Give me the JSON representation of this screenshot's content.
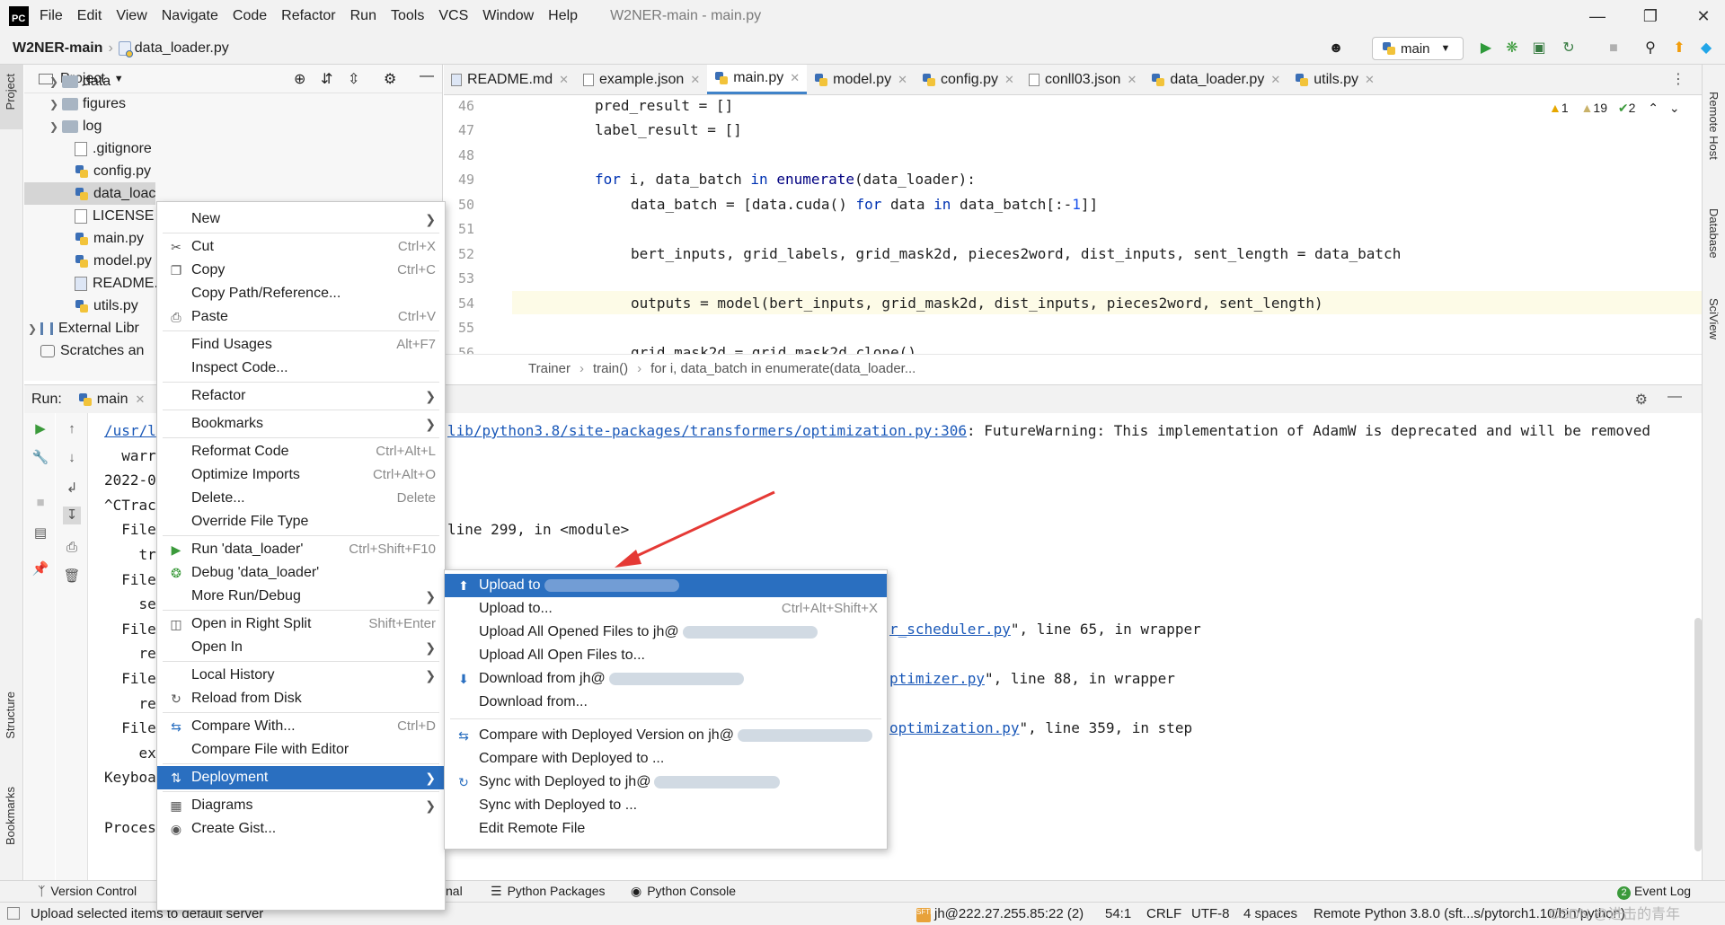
{
  "menubar": {
    "items": [
      "File",
      "Edit",
      "View",
      "Navigate",
      "Code",
      "Refactor",
      "Run",
      "Tools",
      "VCS",
      "Window",
      "Help"
    ],
    "window_title": "W2NER-main - main.py"
  },
  "navbar": {
    "project": "W2NER-main",
    "file": "data_loader.py",
    "run_config": "main"
  },
  "project_panel": {
    "title": "Project",
    "items": [
      {
        "label": "data",
        "kind": "folder"
      },
      {
        "label": "figures",
        "kind": "folder"
      },
      {
        "label": "log",
        "kind": "folder"
      },
      {
        "label": ".gitignore",
        "kind": "file"
      },
      {
        "label": "config.py",
        "kind": "py"
      },
      {
        "label": "data_loac",
        "kind": "py"
      },
      {
        "label": "LICENSE",
        "kind": "file"
      },
      {
        "label": "main.py",
        "kind": "py"
      },
      {
        "label": "model.py",
        "kind": "py"
      },
      {
        "label": "README.",
        "kind": "md"
      },
      {
        "label": "utils.py",
        "kind": "py"
      },
      {
        "label": "External Libr",
        "kind": "lib"
      },
      {
        "label": "Scratches an",
        "kind": "scratch"
      }
    ]
  },
  "editor": {
    "tabs": [
      {
        "label": "README.md",
        "active": false
      },
      {
        "label": "example.json",
        "active": false
      },
      {
        "label": "main.py",
        "active": true
      },
      {
        "label": "model.py",
        "active": false
      },
      {
        "label": "config.py",
        "active": false
      },
      {
        "label": "conll03.json",
        "active": false
      },
      {
        "label": "data_loader.py",
        "active": false
      },
      {
        "label": "utils.py",
        "active": false
      }
    ],
    "inspections": {
      "warnings": "1",
      "weak_warnings": "19",
      "ok": "2"
    },
    "line_numbers": [
      "46",
      "47",
      "48",
      "49",
      "50",
      "51",
      "52",
      "53",
      "54",
      "55",
      "56"
    ],
    "breadcrumb": [
      "Trainer",
      "train()",
      "for i, data_batch in enumerate(data_loader..."
    ]
  },
  "run_panel": {
    "label": "Run:",
    "tab": "main",
    "lines": [
      {
        "left": "/usr/l",
        "right_link": "lib/python3.8/site-packages/transformers/optimization.py:306",
        "right_text": ": FutureWarning: This implementation of AdamW is deprecated and will be removed"
      },
      {
        "left": "  warr",
        "right_link": "",
        "right_text": ""
      },
      {
        "left": "2022-0",
        "right_link": "",
        "right_text": ""
      },
      {
        "left": "^CTrac",
        "right_link": "",
        "right_text": ""
      },
      {
        "left": "  File",
        "right_link": "",
        "right_text": "line 299, in <module>"
      },
      {
        "left": "    tr",
        "right_link": "",
        "right_text": ""
      },
      {
        "left": "  File",
        "right_link": "",
        "right_text": ""
      },
      {
        "left": "    se",
        "right_link": "",
        "right_text": ""
      },
      {
        "left": "  File",
        "right_link": "r_scheduler.py",
        "right_text": "\", line 65, in wrapper"
      },
      {
        "left": "    re",
        "right_link": "",
        "right_text": ""
      },
      {
        "left": "  File",
        "right_link": "ptimizer.py",
        "right_text": "\", line 88, in wrapper"
      },
      {
        "left": "    re",
        "right_link": "",
        "right_text": ""
      },
      {
        "left": "  File",
        "right_link": "optimization.py",
        "right_text": "\", line 359, in step"
      },
      {
        "left": "    ex",
        "right_link": "",
        "right_text": ""
      },
      {
        "left": "Keyboa",
        "right_link": "",
        "right_text": ""
      },
      {
        "left": "",
        "right_link": "",
        "right_text": ""
      },
      {
        "left": "Proces",
        "right_link": "",
        "right_text": ""
      }
    ]
  },
  "context_menu": {
    "items": [
      {
        "label": "New",
        "shortcut": "",
        "submenu": true,
        "icon": ""
      },
      {
        "label": "Cut",
        "shortcut": "Ctrl+X",
        "submenu": false,
        "icon": "scissors-icon"
      },
      {
        "label": "Copy",
        "shortcut": "Ctrl+C",
        "submenu": false,
        "icon": "copy-icon"
      },
      {
        "label": "Copy Path/Reference...",
        "shortcut": "",
        "submenu": false,
        "icon": ""
      },
      {
        "label": "Paste",
        "shortcut": "Ctrl+V",
        "submenu": false,
        "icon": "paste-icon"
      },
      {
        "label": "Find Usages",
        "shortcut": "Alt+F7",
        "submenu": false,
        "icon": ""
      },
      {
        "label": "Inspect Code...",
        "shortcut": "",
        "submenu": false,
        "icon": ""
      },
      {
        "label": "Refactor",
        "shortcut": "",
        "submenu": true,
        "icon": ""
      },
      {
        "label": "Bookmarks",
        "shortcut": "",
        "submenu": true,
        "icon": ""
      },
      {
        "label": "Reformat Code",
        "shortcut": "Ctrl+Alt+L",
        "submenu": false,
        "icon": ""
      },
      {
        "label": "Optimize Imports",
        "shortcut": "Ctrl+Alt+O",
        "submenu": false,
        "icon": ""
      },
      {
        "label": "Delete...",
        "shortcut": "Delete",
        "submenu": false,
        "icon": ""
      },
      {
        "label": "Override File Type",
        "shortcut": "",
        "submenu": false,
        "icon": ""
      },
      {
        "label": "Run 'data_loader'",
        "shortcut": "Ctrl+Shift+F10",
        "submenu": false,
        "icon": "run-icon"
      },
      {
        "label": "Debug 'data_loader'",
        "shortcut": "",
        "submenu": false,
        "icon": "debug-icon"
      },
      {
        "label": "More Run/Debug",
        "shortcut": "",
        "submenu": true,
        "icon": ""
      },
      {
        "label": "Open in Right Split",
        "shortcut": "Shift+Enter",
        "submenu": false,
        "icon": "split-icon"
      },
      {
        "label": "Open In",
        "shortcut": "",
        "submenu": true,
        "icon": ""
      },
      {
        "label": "Local History",
        "shortcut": "",
        "submenu": true,
        "icon": ""
      },
      {
        "label": "Reload from Disk",
        "shortcut": "",
        "submenu": false,
        "icon": "reload-icon"
      },
      {
        "label": "Compare With...",
        "shortcut": "Ctrl+D",
        "submenu": false,
        "icon": "compare-icon"
      },
      {
        "label": "Compare File with Editor",
        "shortcut": "",
        "submenu": false,
        "icon": ""
      },
      {
        "label": "Deployment",
        "shortcut": "",
        "submenu": true,
        "icon": "deployment-icon",
        "selected": true
      },
      {
        "label": "Diagrams",
        "shortcut": "",
        "submenu": true,
        "icon": "diagram-icon"
      },
      {
        "label": "Create Gist...",
        "shortcut": "",
        "submenu": false,
        "icon": "github-icon"
      }
    ]
  },
  "deployment_submenu": {
    "items": [
      {
        "label": "Upload to",
        "shortcut": "",
        "icon": "upload-icon",
        "selected": true
      },
      {
        "label": "Upload to...",
        "shortcut": "Ctrl+Alt+Shift+X",
        "icon": ""
      },
      {
        "label": "Upload All Opened Files to jh@",
        "shortcut": "",
        "icon": ""
      },
      {
        "label": "Upload All Open Files to...",
        "shortcut": "",
        "icon": ""
      },
      {
        "label": "Download from jh@",
        "shortcut": "",
        "icon": "download-icon"
      },
      {
        "label": "Download from...",
        "shortcut": "",
        "icon": ""
      },
      {
        "label": "Compare with Deployed Version on jh@",
        "shortcut": "",
        "icon": "compare-icon"
      },
      {
        "label": "Compare with Deployed to ...",
        "shortcut": "",
        "icon": ""
      },
      {
        "label": "Sync with Deployed to jh@",
        "shortcut": "",
        "icon": "sync-icon"
      },
      {
        "label": "Sync with Deployed to ...",
        "shortcut": "",
        "icon": ""
      },
      {
        "label": "Edit Remote File",
        "shortcut": "",
        "icon": ""
      }
    ]
  },
  "bottom_tabs": {
    "version_control": "Version Control",
    "terminal_partial": "nal",
    "python_packages": "Python Packages",
    "python_console": "Python Console",
    "event_log": "Event Log",
    "event_count": "2"
  },
  "statusbar": {
    "message": "Upload selected items to default server",
    "server": "jh@222.27.255.85:22 (2)",
    "position": "54:1",
    "line_sep": "CRLF",
    "encoding": "UTF-8",
    "indent": "4 spaces",
    "interpreter": "Remote Python 3.8.0 (sft...s/pytorch1.10/bin/python)",
    "watermark": "CSDN @进击的青年"
  },
  "tool_windows": {
    "left": [
      "Project",
      "Structure",
      "Bookmarks"
    ],
    "right": [
      "Remote Host",
      "Database",
      "SciView"
    ]
  },
  "colors": {
    "selection": "#2a6fc0",
    "link": "#1a58b8",
    "keyword": "#0033b3",
    "annotation_arrow": "#e53935"
  }
}
